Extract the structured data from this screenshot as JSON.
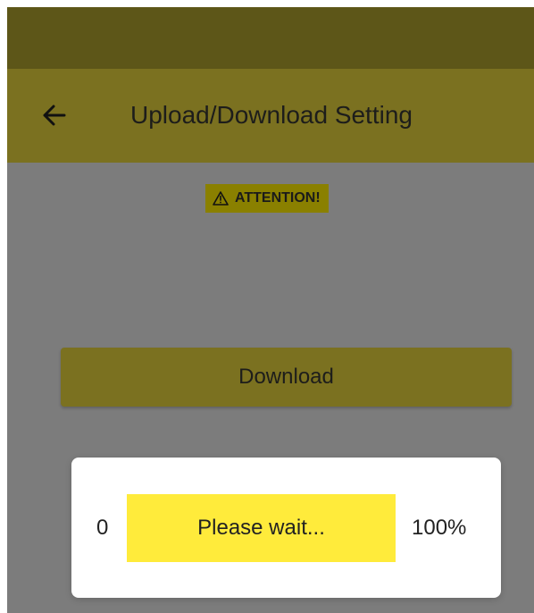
{
  "colors": {
    "status_bar": "#5d5618",
    "app_bar": "#7b7120",
    "screen_dim": "#7c7c7c",
    "attention_background": "#8a8000",
    "download_button": "#7b7120",
    "dialog_background": "#ffffff",
    "progress_track": "#f1e27c",
    "progress_fill": "#ffeb3b"
  },
  "header": {
    "back_icon": "arrow-left-icon",
    "title": "Upload/Download Setting"
  },
  "attention": {
    "icon": "warning-triangle-icon",
    "label": "ATTENTION!"
  },
  "actions": {
    "download_label": "Download"
  },
  "progress": {
    "min_label": "0",
    "max_label": "100%",
    "message": "Please wait...",
    "value": 100
  }
}
